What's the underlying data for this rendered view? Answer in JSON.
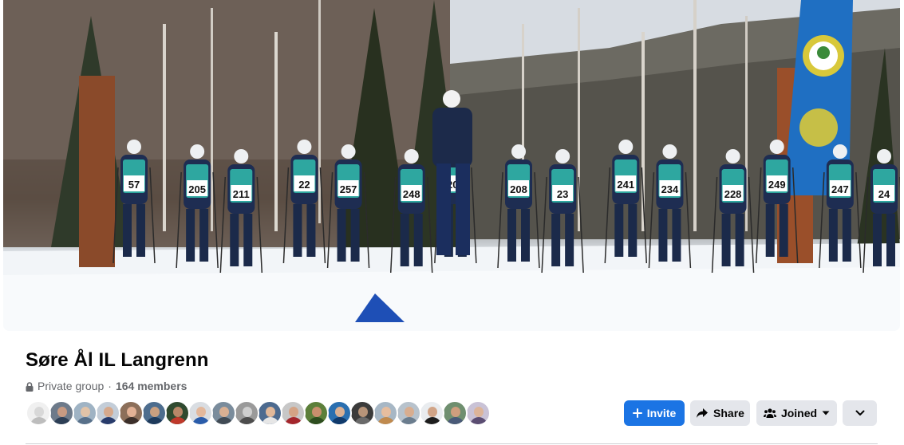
{
  "group": {
    "name": "Søre Ål IL Langrenn",
    "privacy": "Private group",
    "separator": "·",
    "members": "164 members"
  },
  "cover": {
    "banner_color": "#1f6fc2",
    "bibs": [
      "57",
      "205",
      "211",
      "22",
      "257",
      "248",
      "207",
      "208",
      "23",
      "241",
      "234",
      "228",
      "249",
      "247",
      "24"
    ]
  },
  "avatars": [
    {
      "skin": "#d8d8d8",
      "bg": "#f0f0f0",
      "shirt": "#bdbdbd"
    },
    {
      "skin": "#c79a82",
      "bg": "#6d7a8a",
      "shirt": "#2c3e55"
    },
    {
      "skin": "#e1c3a8",
      "bg": "#9fb3c4",
      "shirt": "#58708a"
    },
    {
      "skin": "#d6a98c",
      "bg": "#c3cdd8",
      "shirt": "#283b6b"
    },
    {
      "skin": "#e2b195",
      "bg": "#8c6f5a",
      "shirt": "#3b2f2a"
    },
    {
      "skin": "#caa080",
      "bg": "#4d6d8e",
      "shirt": "#1f3b5c"
    },
    {
      "skin": "#b88768",
      "bg": "#2f4a2f",
      "shirt": "#c0392b"
    },
    {
      "skin": "#e3b89c",
      "bg": "#d9dde2",
      "shirt": "#2a5caa"
    },
    {
      "skin": "#d9b093",
      "bg": "#7a8c9c",
      "shirt": "#414b55"
    },
    {
      "skin": "#cfcfcf",
      "bg": "#9a9a9a",
      "shirt": "#4d4d4d"
    },
    {
      "skin": "#e0b89a",
      "bg": "#4c6a8f",
      "shirt": "#e6e6e6"
    },
    {
      "skin": "#d4a385",
      "bg": "#c7c7c7",
      "shirt": "#a4262c"
    },
    {
      "skin": "#c98f6d",
      "bg": "#5c7f3a",
      "shirt": "#2e4d1f"
    },
    {
      "skin": "#d9b094",
      "bg": "#2a6fb0",
      "shirt": "#103a6b"
    },
    {
      "skin": "#b79479",
      "bg": "#3b3b3b",
      "shirt": "#6a6a6a"
    },
    {
      "skin": "#e6bd9e",
      "bg": "#a7b7c5",
      "shirt": "#c08a4e"
    },
    {
      "skin": "#d8ad8f",
      "bg": "#b7c2cc",
      "shirt": "#6b7d8e"
    },
    {
      "skin": "#d1a487",
      "bg": "#e9ecef",
      "shirt": "#1d1d1d"
    },
    {
      "skin": "#cf9e7e",
      "bg": "#6f8f6f",
      "shirt": "#4a5a78"
    },
    {
      "skin": "#dcb499",
      "bg": "#c9c2d6",
      "shirt": "#5b4d72"
    }
  ],
  "actions": {
    "invite_label": "Invite",
    "share_label": "Share",
    "joined_label": "Joined",
    "accent": "#1b74e4"
  },
  "icons": {
    "lock": "lock-icon",
    "invite": "plus-icon",
    "share": "share-arrow-icon",
    "joined": "people-icon",
    "joined_dropdown": "caret-down-icon",
    "more": "chevron-down-icon"
  }
}
